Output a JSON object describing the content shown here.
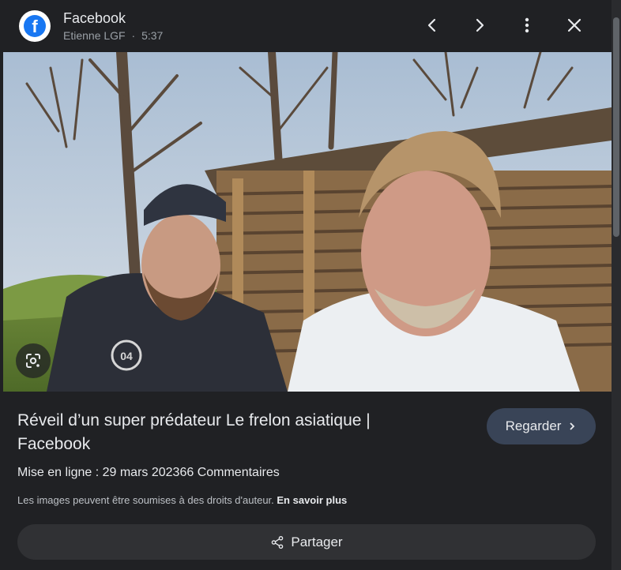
{
  "header": {
    "source_name": "Facebook",
    "author": "Etienne LGF",
    "separator": "·",
    "duration": "5:37",
    "logo_letter": "f",
    "icons": [
      "facebook-logo",
      "chevron-left-icon",
      "chevron-right-icon",
      "more-vert-icon",
      "close-icon"
    ]
  },
  "image": {
    "alt": "Réveil d’un super prédateur Le frelon asiatique | Facebook",
    "shirt_print": "04",
    "lens_icon": "google-lens-icon"
  },
  "details": {
    "title": "Réveil d’un super prédateur Le frelon asiatique | Facebook",
    "watch_label": "Regarder",
    "uploaded": "Mise en ligne : 29 mars 202366 Commentaires",
    "copyright_text": "Les images peuvent être soumises à des droits d'auteur. ",
    "learn_more": "En savoir plus",
    "share_label": "Partager"
  },
  "colors": {
    "background": "#202124",
    "watch_button": "#394457",
    "share_button": "#303134",
    "facebook_blue": "#1877f2"
  }
}
